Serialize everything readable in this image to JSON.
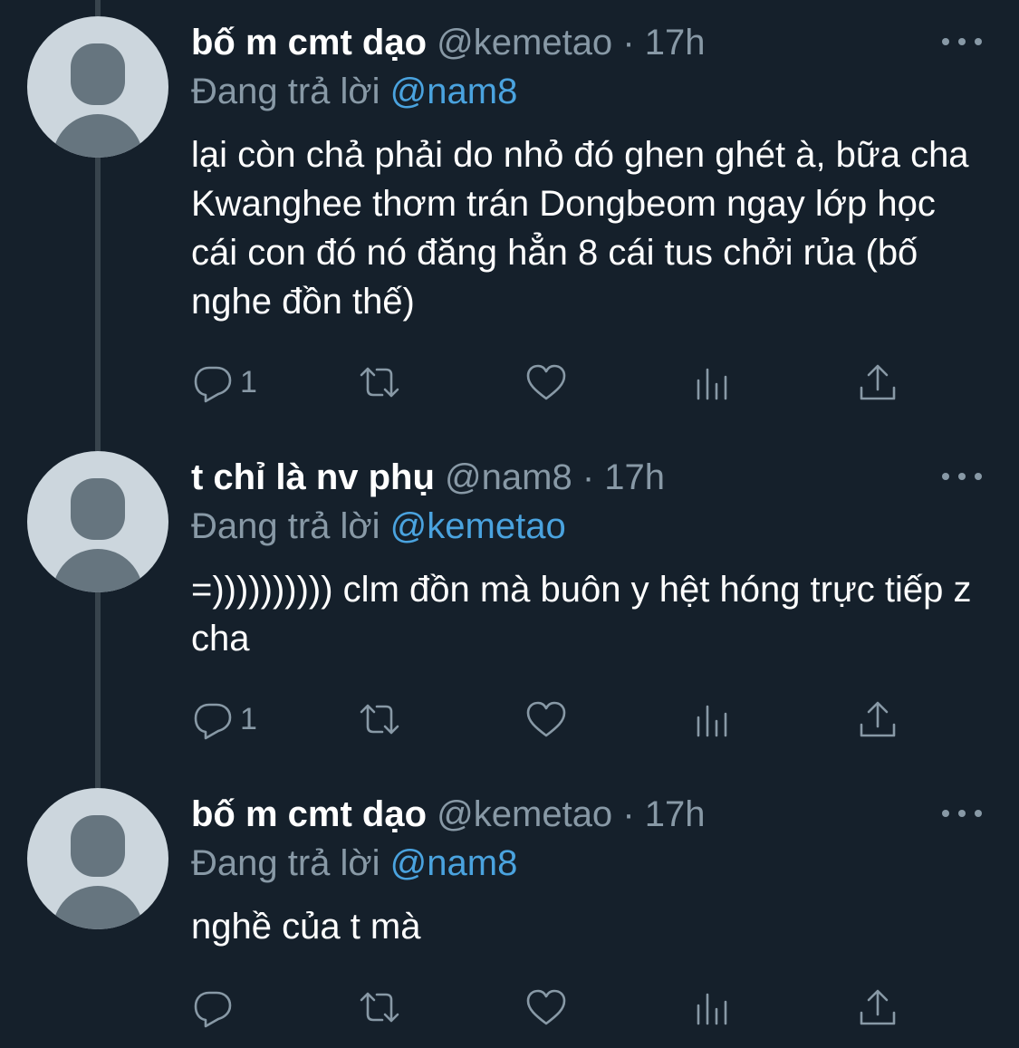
{
  "tweets": [
    {
      "display_name": "bố m cmt dạo",
      "handle": "@kemetao",
      "separator": "·",
      "time": "17h",
      "replying_prefix": "Đang trả lời",
      "replying_to": "@nam8",
      "text": "lại còn chả phải do nhỏ đó ghen ghét à, bữa cha Kwanghee thơm trán Dongbeom ngay lớp học cái con đó nó đăng hẳn 8 cái tus chởi rủa (bố nghe đồn thế)",
      "reply_count": "1",
      "icons": [
        "reply-icon",
        "retweet-icon",
        "like-icon",
        "analytics-icon",
        "share-icon"
      ]
    },
    {
      "display_name": "t chỉ là nv phụ",
      "handle": "@nam8",
      "separator": "·",
      "time": "17h",
      "replying_prefix": "Đang trả lời",
      "replying_to": "@kemetao",
      "text": "=)))))))))) clm đồn mà buôn y hệt hóng trực tiếp z cha",
      "reply_count": "1",
      "icons": [
        "reply-icon",
        "retweet-icon",
        "like-icon",
        "analytics-icon",
        "share-icon"
      ]
    },
    {
      "display_name": "bố m cmt dạo",
      "handle": "@kemetao",
      "separator": "·",
      "time": "17h",
      "replying_prefix": "Đang trả lời",
      "replying_to": "@nam8",
      "text": "nghề của t mà",
      "reply_count": "",
      "icons": [
        "reply-icon",
        "retweet-icon",
        "like-icon",
        "analytics-icon",
        "share-icon"
      ]
    }
  ],
  "colors": {
    "background": "#15202b",
    "secondary_text": "#8899a6",
    "mention": "#4aa3df",
    "thread_line": "#38444d"
  }
}
